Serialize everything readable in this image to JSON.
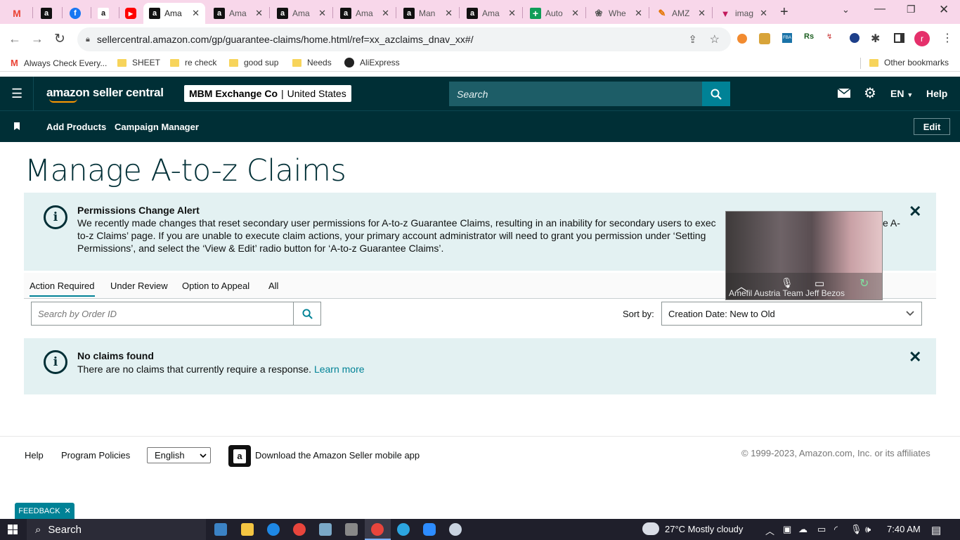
{
  "browser": {
    "tabs": [
      {
        "label": "",
        "favicon": "gmail-icon",
        "color": "#ea4335"
      },
      {
        "label": "",
        "favicon": "amazon-icon",
        "color": "#111111"
      },
      {
        "label": "",
        "favicon": "facebook-icon",
        "color": "#1877f2"
      },
      {
        "label": "",
        "favicon": "amazon-smile-icon",
        "color": "#ff9900"
      },
      {
        "label": "",
        "favicon": "youtube-icon",
        "color": "#ff0000"
      },
      {
        "label": "Ama",
        "favicon": "amazon-icon",
        "color": "#111111",
        "active": true
      },
      {
        "label": "Ama",
        "favicon": "amazon-icon",
        "color": "#111111"
      },
      {
        "label": "Ama",
        "favicon": "amazon-icon",
        "color": "#111111"
      },
      {
        "label": "Ama",
        "favicon": "amazon-icon",
        "color": "#111111"
      },
      {
        "label": "Man",
        "favicon": "amazon-icon",
        "color": "#111111"
      },
      {
        "label": "Ama",
        "favicon": "amazon-icon",
        "color": "#111111"
      },
      {
        "label": "Auto",
        "favicon": "sheets-plus-icon",
        "color": "#0f9d58"
      },
      {
        "label": "Whe",
        "favicon": "paw-icon",
        "color": "#555555"
      },
      {
        "label": "AMZ",
        "favicon": "pen-icon",
        "color": "#e37400"
      },
      {
        "label": "imag",
        "favicon": "heart-icon",
        "color": "#c2185b"
      }
    ],
    "url": "sellercentral.amazon.com/gp/guarantee-claims/home.html/ref=xx_azclaims_dnav_xx#/",
    "profile_initial": "r",
    "bookmarks": [
      {
        "label": "Always Check Every...",
        "icon": "gmail-icon"
      },
      {
        "label": "SHEET",
        "icon": "folder-icon"
      },
      {
        "label": "re check",
        "icon": "folder-icon"
      },
      {
        "label": "good sup",
        "icon": "folder-icon"
      },
      {
        "label": "Needs",
        "icon": "folder-icon"
      },
      {
        "label": "AliExpress",
        "icon": "globe-icon"
      }
    ],
    "other_bookmarks": "Other bookmarks"
  },
  "header": {
    "logo": "amazon seller central",
    "account_name": "MBM Exchange Co",
    "account_region": "United States",
    "search_placeholder": "Search",
    "language": "EN",
    "help": "Help"
  },
  "nav": {
    "items": [
      "Add Products",
      "Campaign Manager"
    ],
    "edit": "Edit"
  },
  "page": {
    "title": "Manage A-to-z Claims",
    "permission_alert": {
      "title": "Permissions Change Alert",
      "line1": "We recently made changes that reset secondary user permissions for A-to-z Guarantee Claims, resulting in an inability for secondary users to exec",
      "line1_tail": "e A-",
      "line2": "to-z Claims’ page. If you are unable to execute claim actions, your primary account administrator will need to grant you permission under ‘Setting",
      "line3": "Permissions’, and select the ‘View & Edit’ radio button for ‘A-to-z Guarantee Claims’."
    },
    "tabs": [
      "Action Required",
      "Under Review",
      "Option to Appeal",
      "All"
    ],
    "order_search_placeholder": "Search by Order ID",
    "sort_label": "Sort by:",
    "sort_value": "Creation Date: New to Old",
    "no_claims": {
      "title": "No claims found",
      "text": "There are no claims that currently require a response.",
      "link": "Learn more"
    }
  },
  "footer": {
    "help": "Help",
    "policies": "Program Policies",
    "language": "English",
    "app_text": "Download the Amazon Seller mobile app",
    "copyright": "© 1999-2023, Amazon.com, Inc. or its affiliates",
    "feedback": "FEEDBACK"
  },
  "video_overlay": {
    "name": "Amefil Austria Team Jeff Bezos"
  },
  "taskbar": {
    "search": "Search",
    "weather": "27°C  Mostly cloudy",
    "time": "7:40 AM"
  }
}
